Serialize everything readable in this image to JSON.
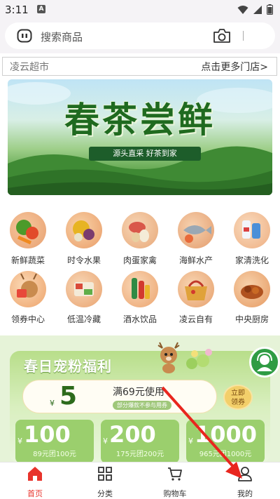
{
  "status_bar": {
    "time": "3:11",
    "notification_letter": "A"
  },
  "search": {
    "placeholder": "搜索商品"
  },
  "store": {
    "name": "凌云超市",
    "more_label": "点击更多门店>"
  },
  "banner": {
    "title": "春茶尝鲜",
    "subtitle": "源头直采 好茶到家"
  },
  "categories": [
    {
      "label": "新鲜蔬菜",
      "icon": "vegetables-icon"
    },
    {
      "label": "时令水果",
      "icon": "fruit-icon"
    },
    {
      "label": "肉蛋家禽",
      "icon": "meat-eggs-icon"
    },
    {
      "label": "海鲜水产",
      "icon": "seafood-icon"
    },
    {
      "label": "家清洗化",
      "icon": "household-cleaning-icon"
    },
    {
      "label": "领券中心",
      "icon": "coupon-center-icon"
    },
    {
      "label": "低温冷藏",
      "icon": "chilled-food-icon"
    },
    {
      "label": "酒水饮品",
      "icon": "drinks-icon"
    },
    {
      "label": "凌云自有",
      "icon": "own-brand-icon"
    },
    {
      "label": "中央厨房",
      "icon": "central-kitchen-icon"
    }
  ],
  "promo": {
    "title": "春日宠粉福利",
    "main_coupon": {
      "currency": "¥",
      "amount": "5",
      "condition": "满69元使用",
      "note": "部分爆款不参与用券",
      "claim_label_1": "立即",
      "claim_label_2": "领券"
    },
    "coupons": [
      {
        "currency": "¥",
        "amount": "100",
        "condition": "89元团100元"
      },
      {
        "currency": "¥",
        "amount": "200",
        "condition": "175元团200元"
      },
      {
        "currency": "¥",
        "amount": "1000",
        "condition": "965元团1000元"
      }
    ]
  },
  "tabs": [
    {
      "label": "首页",
      "icon": "home-icon",
      "active": true
    },
    {
      "label": "分类",
      "icon": "grid-icon",
      "active": false
    },
    {
      "label": "购物车",
      "icon": "cart-icon",
      "active": false
    },
    {
      "label": "我的",
      "icon": "user-icon",
      "active": false
    }
  ],
  "colors": {
    "accent": "#e8332b",
    "green": "#2d6b1c",
    "promo_bg": "#e6f3d8"
  }
}
